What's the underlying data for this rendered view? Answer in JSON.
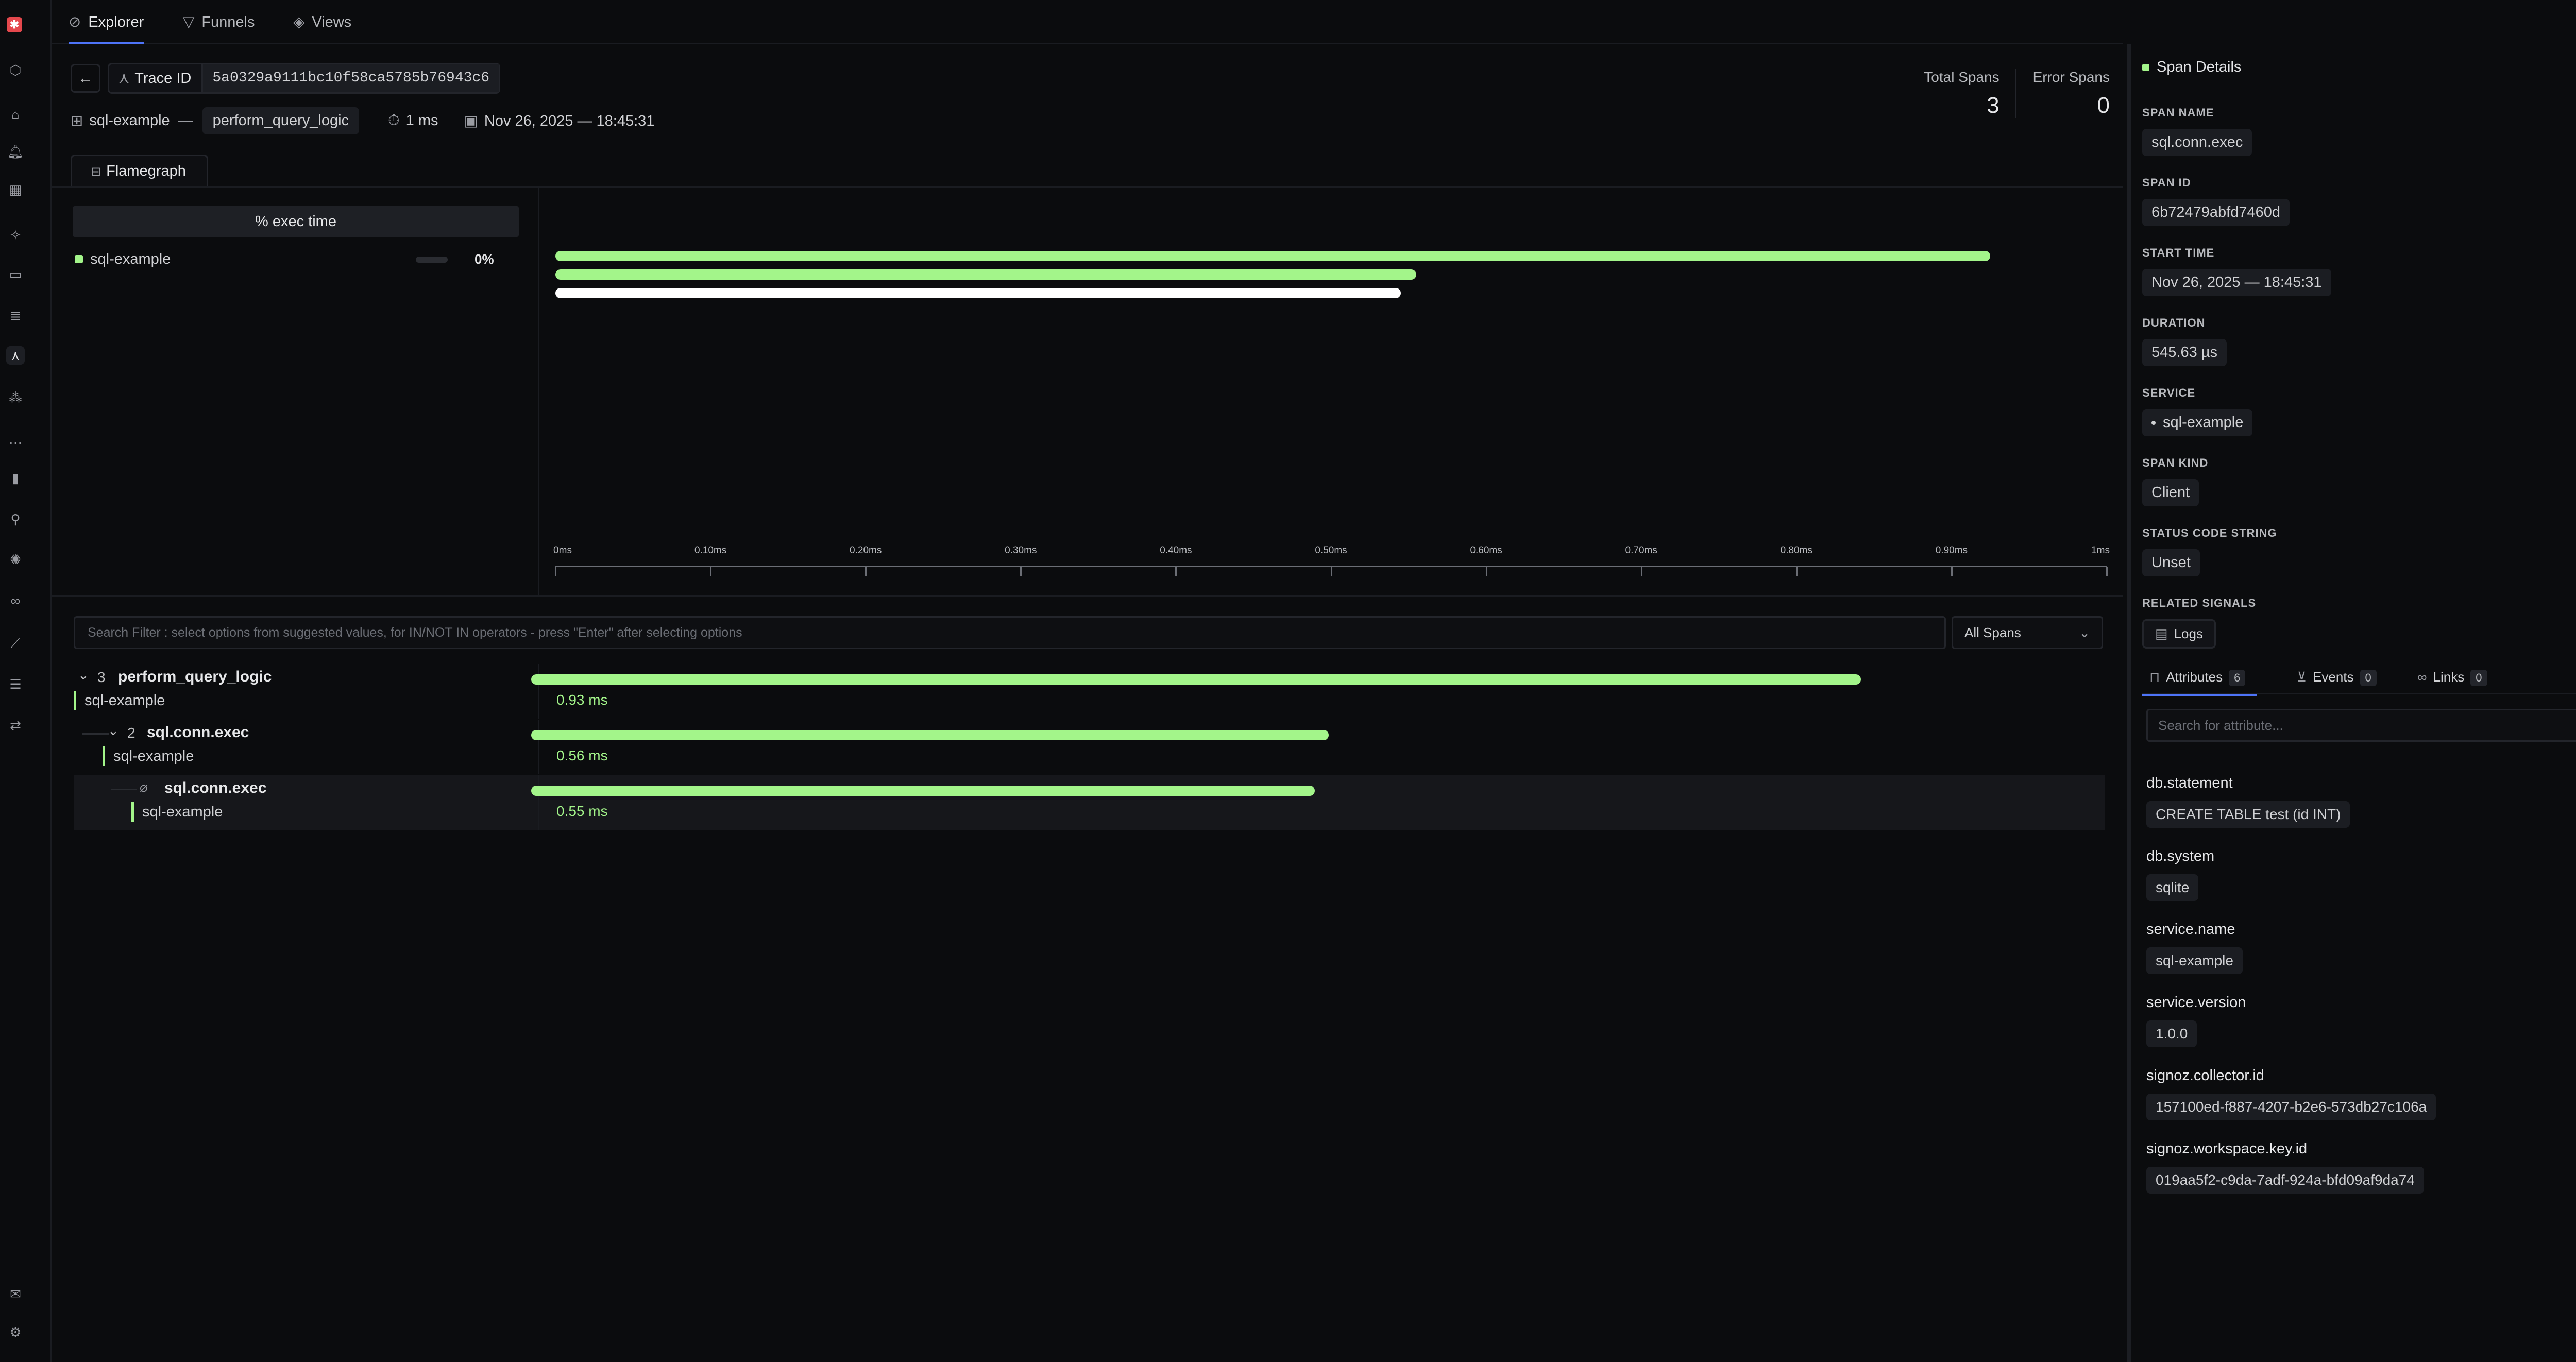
{
  "nav": {
    "tabs": [
      {
        "label": "Explorer",
        "icon": "compass-icon",
        "active": true
      },
      {
        "label": "Funnels",
        "icon": "funnel-icon",
        "active": false
      },
      {
        "label": "Views",
        "icon": "layers-icon",
        "active": false
      }
    ]
  },
  "trace": {
    "id_label": "Trace ID",
    "id_value": "5a0329a9111bc10f58ca5785b76943c6",
    "service": "sql-example",
    "separator": "—",
    "root_span": "perform_query_logic",
    "duration": "1 ms",
    "timestamp": "Nov 26, 2025 — 18:45:31"
  },
  "stats": {
    "total_spans_label": "Total Spans",
    "total_spans_value": "3",
    "error_spans_label": "Error Spans",
    "error_spans_value": "0"
  },
  "flamegraph": {
    "tab_label": "Flamegraph",
    "exec_header": "% exec time",
    "service_row": {
      "name": "sql-example",
      "percent": "0%",
      "fraction": 0.0
    },
    "bars": [
      {
        "start_ms": 0.0,
        "end_ms": 0.925,
        "color": "#a3f58a"
      },
      {
        "start_ms": 0.0,
        "end_ms": 0.555,
        "color": "#a3f58a"
      },
      {
        "start_ms": 0.0,
        "end_ms": 0.545,
        "color": "#ffffff"
      }
    ],
    "axis_max_ms": 1.0,
    "ticks": [
      {
        "label": "0ms",
        "value": 0.0
      },
      {
        "label": "0.10ms",
        "value": 0.1
      },
      {
        "label": "0.20ms",
        "value": 0.2
      },
      {
        "label": "0.30ms",
        "value": 0.3
      },
      {
        "label": "0.40ms",
        "value": 0.4
      },
      {
        "label": "0.50ms",
        "value": 0.5
      },
      {
        "label": "0.60ms",
        "value": 0.6
      },
      {
        "label": "0.70ms",
        "value": 0.7
      },
      {
        "label": "0.80ms",
        "value": 0.8
      },
      {
        "label": "0.90ms",
        "value": 0.9
      },
      {
        "label": "1ms",
        "value": 1.0
      }
    ]
  },
  "filter": {
    "placeholder": "Search Filter : select options from suggested values, for IN/NOT IN operators - press \"Enter\" after selecting options",
    "select_value": "All Spans"
  },
  "spans": [
    {
      "name": "perform_query_logic",
      "service": "sql-example",
      "children": "3",
      "duration": "0.93 ms",
      "start_ms": 0.0,
      "dur_ms": 0.925
    },
    {
      "name": "sql.conn.exec",
      "service": "sql-example",
      "children": "2",
      "duration": "0.56 ms",
      "start_ms": 0.0,
      "dur_ms": 0.555
    },
    {
      "name": "sql.conn.exec",
      "service": "sql-example",
      "children": "",
      "duration": "0.55 ms",
      "start_ms": 0.0,
      "dur_ms": 0.545
    }
  ],
  "details": {
    "title": "Span Details",
    "span_name_label": "SPAN NAME",
    "span_name": "sql.conn.exec",
    "span_id_label": "SPAN ID",
    "span_id": "6b72479abfd7460d",
    "start_time_label": "START TIME",
    "start_time": "Nov 26, 2025 — 18:45:31",
    "duration_label": "DURATION",
    "duration": "545.63 µs",
    "service_label": "SERVICE",
    "service": "sql-example",
    "span_kind_label": "SPAN KIND",
    "span_kind": "Client",
    "status_label": "STATUS CODE STRING",
    "status": "Unset",
    "related_label": "RELATED SIGNALS",
    "logs_button": "Logs",
    "tabs": {
      "attributes": "Attributes",
      "attributes_count": "6",
      "events": "Events",
      "events_count": "0",
      "links": "Links",
      "links_count": "0"
    },
    "attr_search_placeholder": "Search for attribute...",
    "attributes": [
      {
        "key": "db.statement",
        "value": "CREATE TABLE test (id INT)"
      },
      {
        "key": "db.system",
        "value": "sqlite"
      },
      {
        "key": "service.name",
        "value": "sql-example"
      },
      {
        "key": "service.version",
        "value": "1.0.0"
      },
      {
        "key": "signoz.collector.id",
        "value": "157100ed-f887-4207-b2e6-573db27c106a"
      },
      {
        "key": "signoz.workspace.key.id",
        "value": "019aa5f2-c9da-7adf-924a-bfd09af9da74"
      }
    ]
  }
}
